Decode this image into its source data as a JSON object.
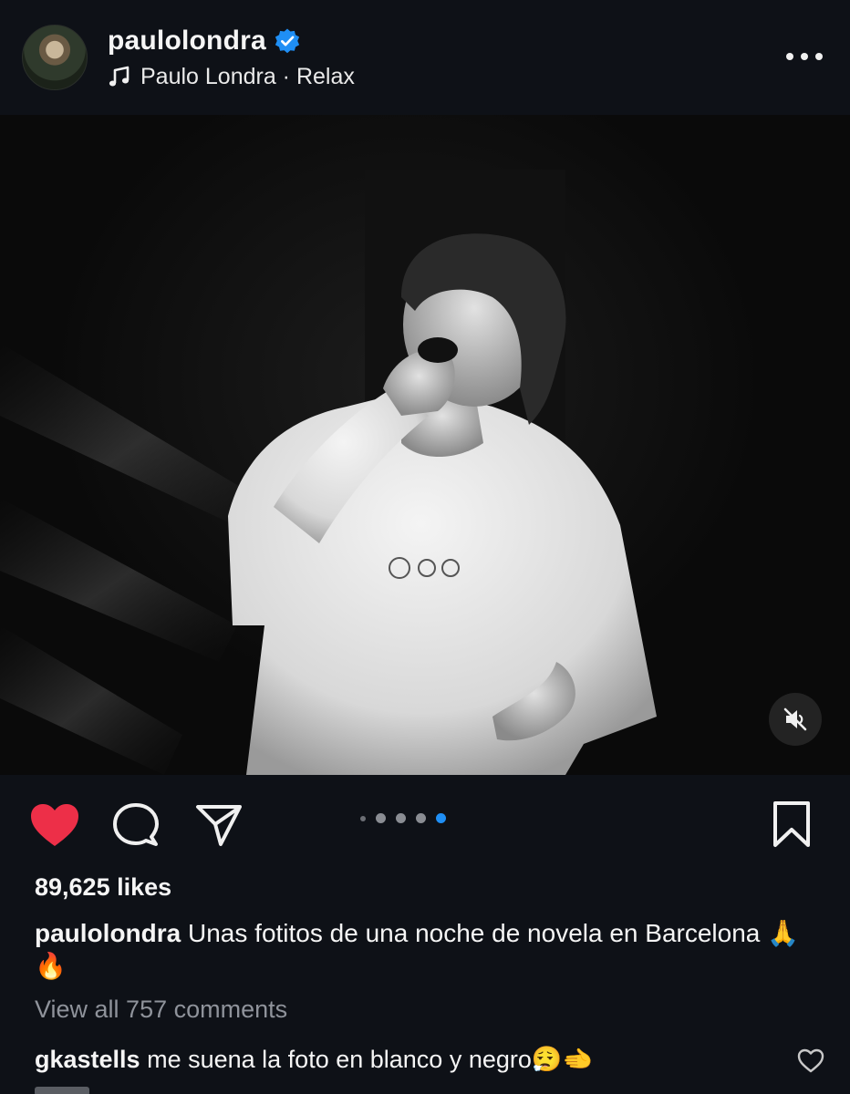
{
  "header": {
    "username": "paulolondra",
    "music": "Paulo Londra · Relax"
  },
  "post": {
    "carousel": {
      "total": 5,
      "active_index": 4
    },
    "likes": "89,625 likes",
    "caption_user": "paulolondra",
    "caption_text": "Unas fotitos de una noche de novela en Barcelona 🙏🔥",
    "view_comments": "View all 757 comments"
  },
  "comment": {
    "user": "gkastells",
    "text": "me suena la foto en blanco y negro😮‍💨🫲"
  },
  "icons": {
    "verified": "verified-badge-icon",
    "music": "music-note-icon",
    "more": "more-options-icon",
    "mute": "muted-speaker-icon",
    "like": "heart-filled-icon",
    "comment": "comment-bubble-icon",
    "share": "paper-plane-icon",
    "save": "bookmark-icon",
    "comment_like": "heart-outline-icon"
  },
  "colors": {
    "background": "#0e1117",
    "like_red": "#ed2f48",
    "verified_blue": "#1f8ff5",
    "active_dot": "#1f8ff5",
    "muted_text": "#8f939b"
  }
}
